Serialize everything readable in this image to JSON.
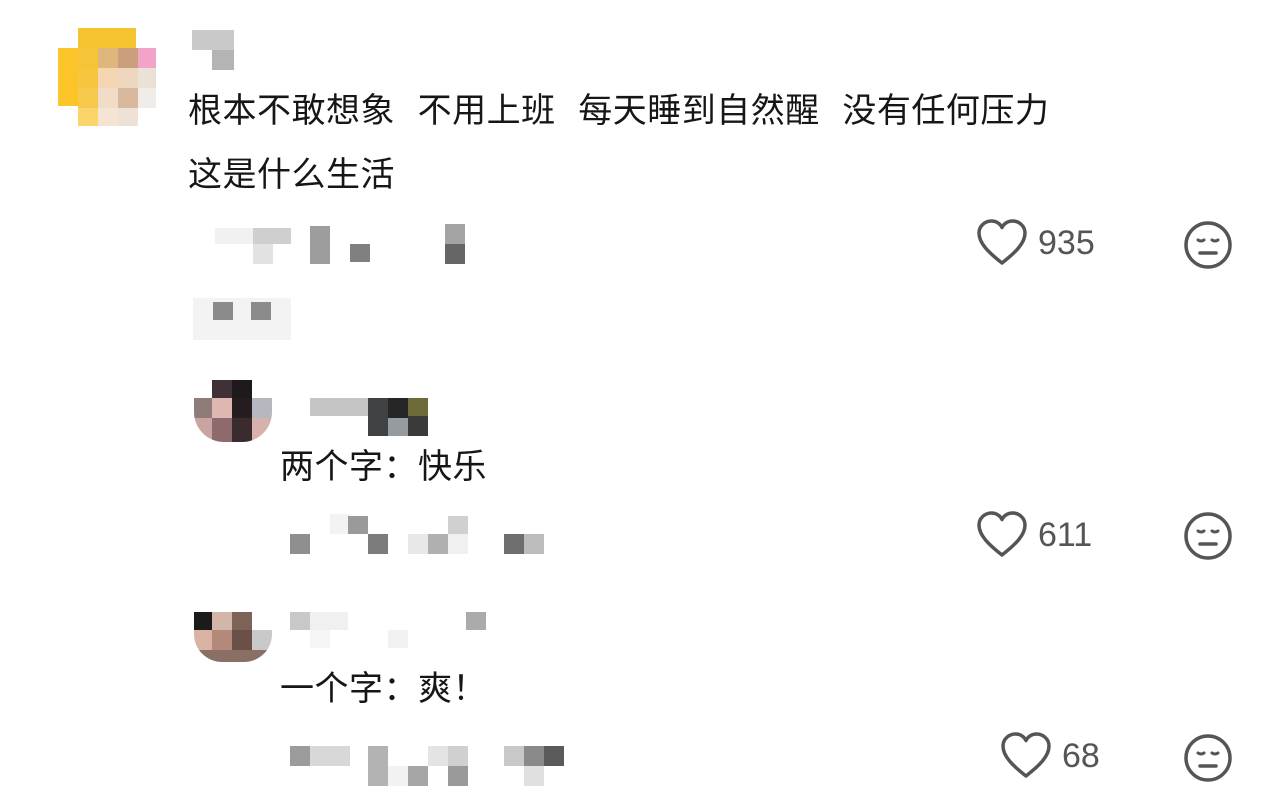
{
  "comments": [
    {
      "text_line1": "根本不敢想象  不用上班  每天睡到自然醒  没有任何压力",
      "text_line2": "这是什么生活",
      "likes": "935",
      "avatar_icon": "cartoon-avatar-icon",
      "react_icon": "neutral-face-icon"
    },
    {
      "text": "两个字：快乐",
      "likes": "611",
      "avatar_icon": "user-avatar-icon",
      "react_icon": "neutral-face-icon"
    },
    {
      "text": "一个字：爽！",
      "likes": "68",
      "avatar_icon": "user-avatar-icon",
      "react_icon": "neutral-face-icon"
    }
  ],
  "colors": {
    "text": "#161616",
    "icon": "#555555",
    "blur_light": "#e8e8e8",
    "blur_mid": "#9a9a9a",
    "blur_dark": "#555555"
  }
}
